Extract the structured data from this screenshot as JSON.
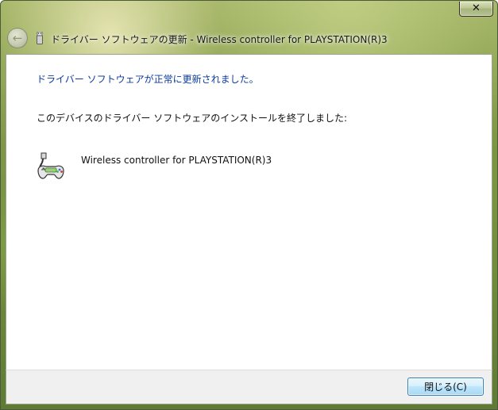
{
  "window": {
    "title": "ドライバー ソフトウェアの更新 - Wireless controller for PLAYSTATION(R)3",
    "close_glyph": "✕",
    "back_glyph": "←"
  },
  "content": {
    "heading": "ドライバー ソフトウェアが正常に更新されました。",
    "description": "このデバイスのドライバー ソフトウェアのインストールを終了しました:",
    "device_name": "Wireless controller for PLAYSTATION(R)3",
    "device_icon": "game-controller-icon"
  },
  "footer": {
    "close_label": "閉じる(C)"
  },
  "colors": {
    "heading": "#0b3b9f",
    "button_border": "#3c7fb1"
  }
}
